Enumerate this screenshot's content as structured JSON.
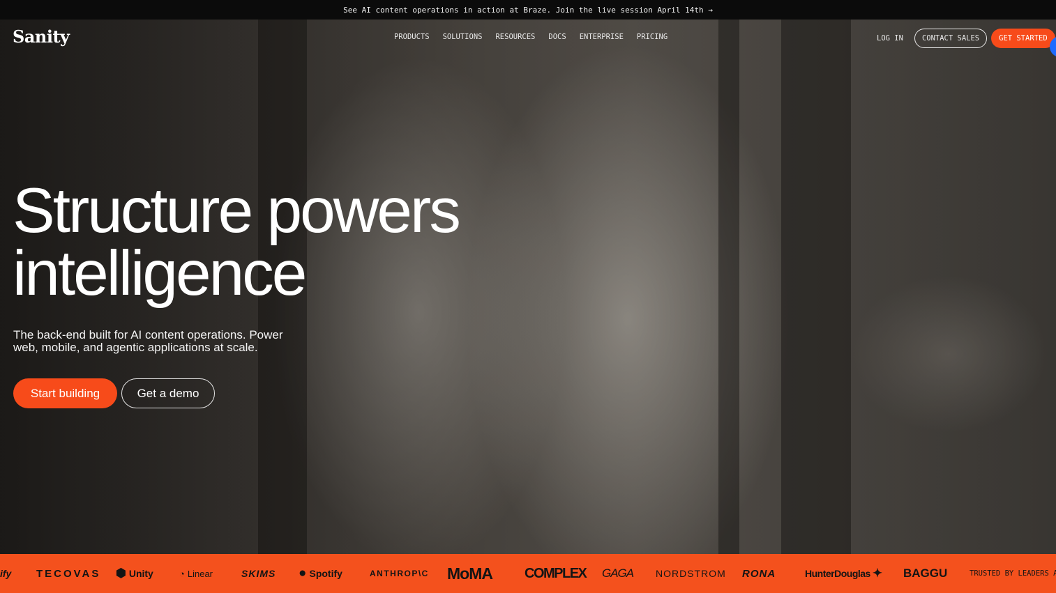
{
  "announcement": {
    "text": "See AI content operations in action at Braze. Join the live session April 14th →"
  },
  "nav": {
    "logo": "Sanity",
    "links": [
      "PRODUCTS",
      "SOLUTIONS",
      "RESOURCES",
      "DOCS",
      "ENTERPRISE",
      "PRICING"
    ],
    "login": "LOG IN",
    "contact_sales": "CONTACT SALES",
    "get_started": "GET STARTED"
  },
  "hero": {
    "headline_line1": "Structure powers",
    "headline_line2": "intelligence",
    "subtext": "The back-end built for AI content operations. Power web, mobile, and agentic applications at scale.",
    "cta_primary": "Start building",
    "cta_secondary": "Get a demo"
  },
  "logos": {
    "items": [
      {
        "label": "ify",
        "icon": ""
      },
      {
        "label": "TECOVAS",
        "icon": ""
      },
      {
        "label": "Unity",
        "icon": "unity-icon"
      },
      {
        "label": "Linear",
        "icon": "linear-icon"
      },
      {
        "label": "SKIMS",
        "icon": ""
      },
      {
        "label": "Spotify",
        "icon": "spotify-icon"
      },
      {
        "label": "ANTHROP\\C",
        "icon": ""
      },
      {
        "label": "MoMA",
        "icon": ""
      },
      {
        "label": "COMPLEX",
        "icon": ""
      },
      {
        "label": "GAGA",
        "icon": ""
      },
      {
        "label": "NORDSTROM",
        "icon": ""
      },
      {
        "label": "RONA",
        "icon": ""
      },
      {
        "label": "HunterDouglas",
        "icon": "hunter-douglas-icon"
      },
      {
        "label": "BAGGU",
        "icon": ""
      }
    ],
    "trusted_text": "TRUSTED BY LEADERS AND"
  },
  "colors": {
    "accent": "#f74b1a",
    "strip": "#f4511d",
    "announce_bg": "#0b0b0b",
    "blue_dot": "#1f6bff"
  }
}
